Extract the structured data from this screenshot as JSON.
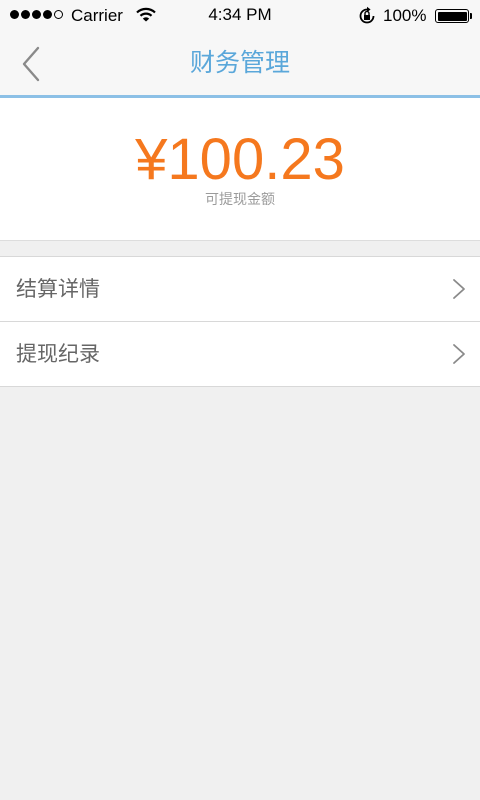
{
  "status_bar": {
    "carrier": "Carrier",
    "time": "4:34 PM",
    "battery_percent": "100%",
    "signal_bars_filled": 4,
    "signal_bars_total": 5
  },
  "nav": {
    "title": "财务管理",
    "back_icon": "chevron-left-icon"
  },
  "balance": {
    "amount": "¥100.23",
    "label": "可提现金额"
  },
  "menu": {
    "items": [
      {
        "label": "结算详情",
        "icon": "chevron-right-icon"
      },
      {
        "label": "提现纪录",
        "icon": "chevron-right-icon"
      }
    ]
  },
  "colors": {
    "accent": "#5aa7da",
    "nav_divider": "#8cc0e6",
    "amount": "#f5781e",
    "background": "#f0f0f0"
  }
}
